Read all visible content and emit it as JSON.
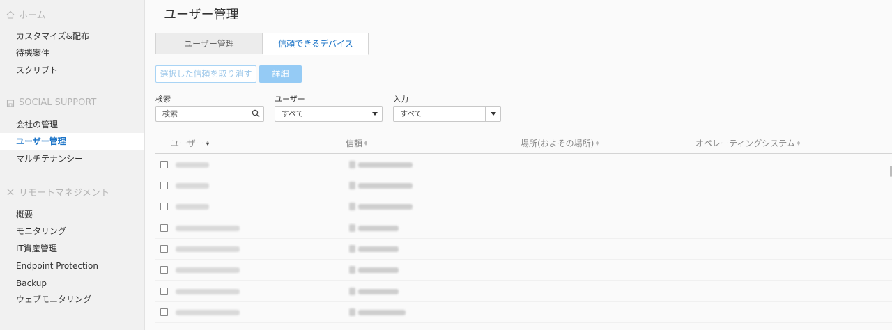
{
  "sidebar": {
    "home_section": "ホーム",
    "home_items": [
      "カスタマイズ&配布",
      "待機案件",
      "スクリプト"
    ],
    "social_section": "SOCIAL SUPPORT",
    "social_items": [
      "会社の管理",
      "ユーザー管理",
      "マルチテナンシー"
    ],
    "remote_section": "リモートマネジメント",
    "remote_items": [
      "概要",
      "モニタリング",
      "IT資産管理",
      "Endpoint Protection",
      "Backup",
      "ウェブモニタリング"
    ],
    "active_item": "ユーザー管理"
  },
  "main": {
    "title": "ユーザー管理",
    "tabs": [
      {
        "label": "ユーザー管理",
        "active": false
      },
      {
        "label": "信頼できるデバイス",
        "active": true
      }
    ],
    "revoke_button": "選択した信頼を取り消す",
    "detail_button": "詳細",
    "filters": {
      "search_label": "検索",
      "search_placeholder": "検索",
      "user_label": "ユーザー",
      "user_value": "すべて",
      "input_label": "入力",
      "input_value": "すべて"
    },
    "columns": [
      "ユーザー",
      "信頼",
      "場所(およその場所)",
      "オペレーティングシステム"
    ],
    "row_count": 8
  },
  "colors": {
    "accent": "#1a73c7",
    "button_primary": "#95cbf5",
    "sidebar_bg": "#f1f1f1"
  }
}
